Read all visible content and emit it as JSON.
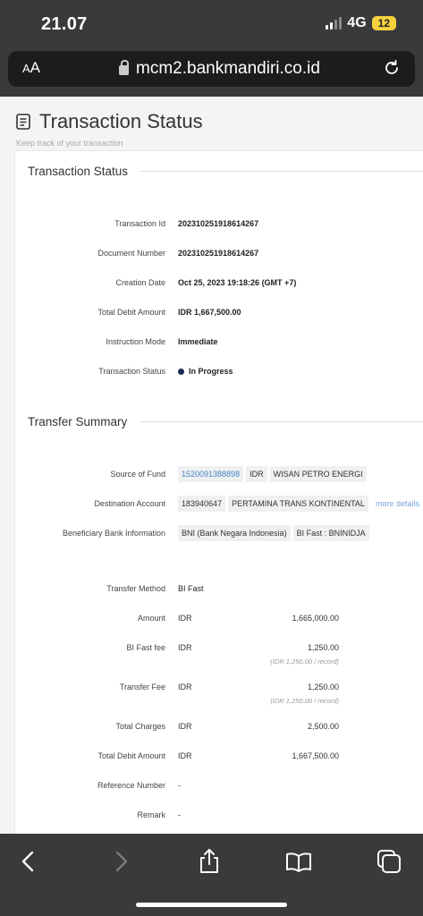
{
  "status_bar": {
    "time": "21.07",
    "network": "4G",
    "battery": "12"
  },
  "url_bar": {
    "aa_label_small": "A",
    "aa_label_large": "A",
    "url": "mcm2.bankmandiri.co.id"
  },
  "page": {
    "title": "Transaction Status",
    "subtitle": "Keep track of your transaction"
  },
  "status_section": {
    "title": "Transaction Status",
    "rows": [
      {
        "label": "Transaction Id",
        "value": "202310251918614267"
      },
      {
        "label": "Document Number",
        "value": "202310251918614267"
      },
      {
        "label": "Creation Date",
        "value": "Oct 25, 2023 19:18:26 (GMT +7)"
      },
      {
        "label": "Total Debit Amount",
        "value": "IDR 1,667,500.00"
      },
      {
        "label": "Instruction Mode",
        "value": "Immediate"
      },
      {
        "label": "Transaction Status",
        "value": "In Progress"
      }
    ]
  },
  "transfer_section": {
    "title": "Transfer Summary",
    "source_of_fund": {
      "label": "Source of Fund",
      "account": "1520091388898",
      "currency": "IDR",
      "name": "WISAN PETRO ENERGI"
    },
    "destination_account": {
      "label": "Destination Account",
      "account": "183940647",
      "name": "PERTAMINA TRANS KONTINENTAL",
      "more": "more details"
    },
    "beneficiary_bank": {
      "label": "Beneficiary Bank Information",
      "bank": "BNI (Bank Negara Indonesia)",
      "code": "BI Fast : BNINIDJA"
    },
    "transfer_method": {
      "label": "Transfer Method",
      "value": "BI Fast"
    },
    "amount": {
      "label": "Amount",
      "currency": "IDR",
      "value": "1,665,000.00"
    },
    "bi_fast_fee": {
      "label": "BI Fast fee",
      "currency": "IDR",
      "value": "1,250.00",
      "note": "(IDR 1,250.00 / record)"
    },
    "transfer_fee": {
      "label": "Transfer Fee",
      "currency": "IDR",
      "value": "1,250.00",
      "note": "(IDR 1,250.00 / record)"
    },
    "total_charges": {
      "label": "Total Charges",
      "currency": "IDR",
      "value": "2,500.00"
    },
    "total_debit": {
      "label": "Total Debit Amount",
      "currency": "IDR",
      "value": "1,667,500.00"
    },
    "reference_number": {
      "label": "Reference Number",
      "value": "-"
    },
    "remark": {
      "label": "Remark",
      "value": "-"
    }
  },
  "colors": {
    "status_dot": "#1d2a55",
    "link": "#4a86c5",
    "battery": "#f4d13d"
  },
  "icons": [
    "signal-icon",
    "lock-icon",
    "reload-icon",
    "document-icon",
    "back-icon",
    "forward-icon",
    "share-icon",
    "bookmarks-icon",
    "tabs-icon"
  ]
}
